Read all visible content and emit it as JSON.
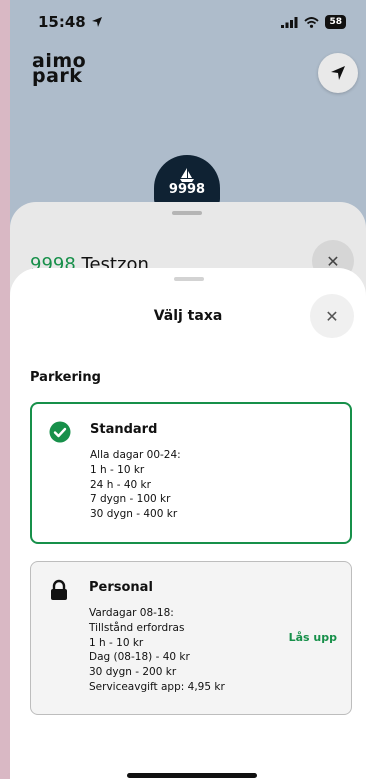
{
  "status_bar": {
    "time": "15:48",
    "battery": "58"
  },
  "logo": {
    "line1": "aimo",
    "line2": "park"
  },
  "map": {
    "zone_pin_number": "9998"
  },
  "zone_sheet": {
    "zone_number": "9998",
    "zone_name": "Testzon"
  },
  "sheet": {
    "title": "Välj taxa",
    "section_label": "Parkering",
    "tariffs": [
      {
        "name": "Standard",
        "selected": true,
        "lines": [
          "Alla dagar 00-24:",
          "1 h - 10 kr",
          "24 h - 40 kr",
          "7 dygn - 100 kr",
          "30 dygn - 400 kr"
        ]
      },
      {
        "name": "Personal",
        "locked": true,
        "unlock_label": "Lås upp",
        "lines": [
          "Vardagar 08-18:",
          "Tillstånd erfordras",
          "1 h - 10 kr",
          "Dag (08-18) - 40 kr",
          "30 dygn - 200 kr",
          "Serviceavgift app: 4,95 kr"
        ]
      }
    ]
  },
  "colors": {
    "accent": "#17904a",
    "map_bg": "#aebccb",
    "pin_bg": "#0f2233"
  }
}
